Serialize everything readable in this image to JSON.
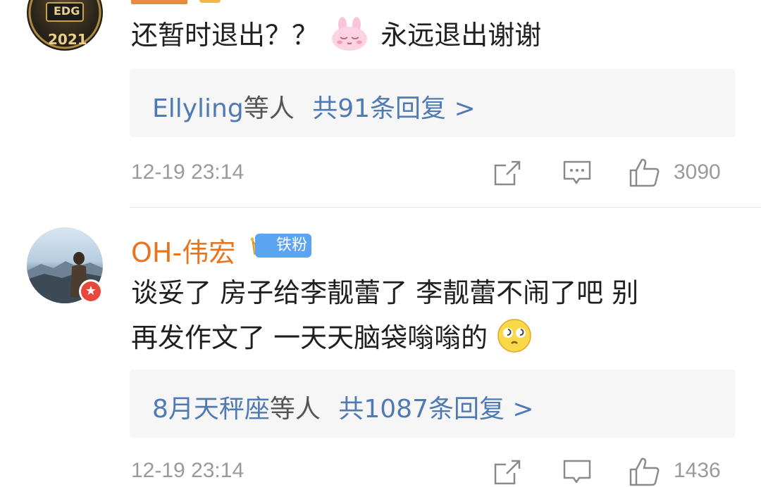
{
  "comments": [
    {
      "text_part1": "还暂时退出？？",
      "text_part2": "永远退出谢谢",
      "emoji_icon": "pink-bunny-emoji",
      "avatar_text": "2021",
      "avatar_logo": "EDG",
      "reply_summary": {
        "names": "Ellyling",
        "suffix": "等人",
        "count_text": "共91条回复 >"
      },
      "timestamp": "12-19 23:14",
      "likes": "3090"
    },
    {
      "username": "OH-伟宏",
      "badge_label": "铁粉",
      "text_line1": "谈妥了 房子给李靓蕾了 李靓蕾不闹了吧 别",
      "text_line2": "再发作文了 一天天脑袋嗡嗡的",
      "emoji_icon": "dizzy-face-emoji",
      "reply_summary": {
        "names": "8月天秤座",
        "suffix": "等人",
        "count_text": "共1087条回复 >"
      },
      "timestamp": "12-19 23:14",
      "likes": "1436"
    }
  ],
  "colors": {
    "username": "#e8741f",
    "reply_link": "#4f7ab3",
    "meta": "#9a9a9a",
    "badge": "#5aa4f2"
  }
}
